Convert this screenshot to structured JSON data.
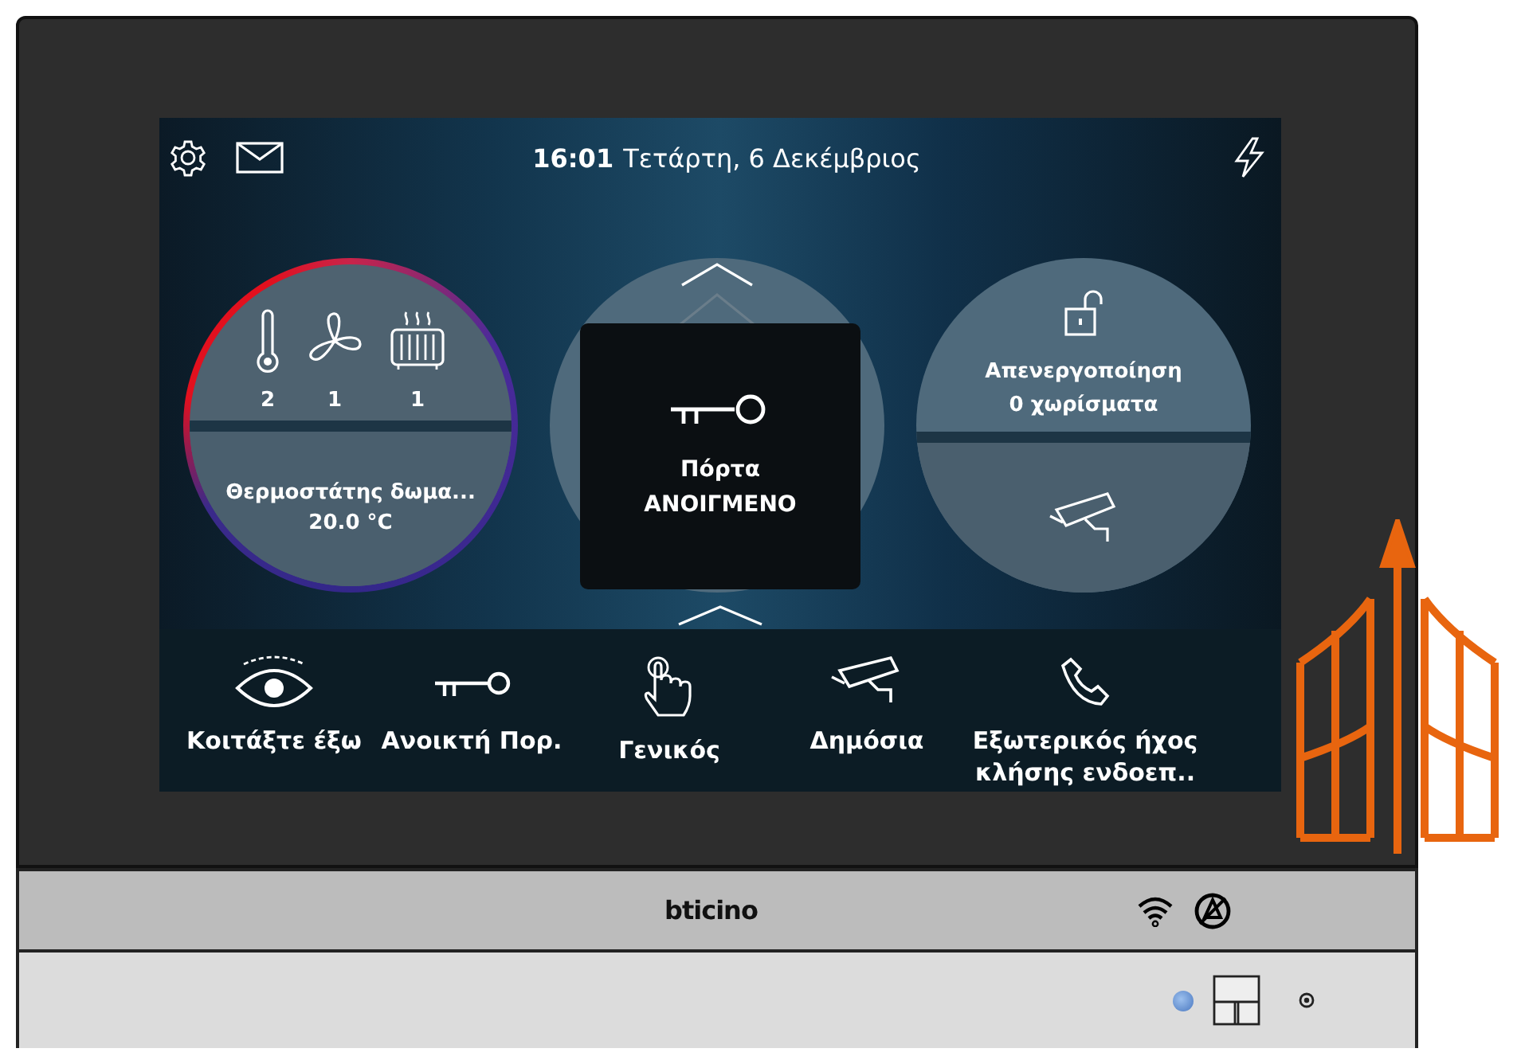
{
  "status_bar": {
    "time": "16:01",
    "date": "Τετάρτη, 6 Δεκέμβριος"
  },
  "thermostat": {
    "zones": [
      {
        "kind": "thermometer",
        "count": "2"
      },
      {
        "kind": "fan",
        "count": "1"
      },
      {
        "kind": "radiator",
        "count": "1"
      }
    ],
    "name": "Θερμοστάτης δωμα...",
    "temperature": "20.0 °C"
  },
  "popup": {
    "title": "Πόρτα",
    "status": "ΑΝΟΙΓΜΕΝΟ"
  },
  "alarm": {
    "status": "Απενεργοποίηση",
    "zones": "0 χωρίσματα"
  },
  "shortcuts": [
    {
      "kind": "eye",
      "label": "Κοιτάξτε έξω"
    },
    {
      "kind": "key",
      "label": "Ανοικτή Πορ."
    },
    {
      "kind": "touch",
      "label": "Γενικός"
    },
    {
      "kind": "camera",
      "label": "Δημόσια"
    },
    {
      "kind": "phone",
      "label": "Εξωτερικός ήχος κλήσης ενδοεπ.."
    }
  ],
  "device": {
    "brand": "bticino"
  }
}
